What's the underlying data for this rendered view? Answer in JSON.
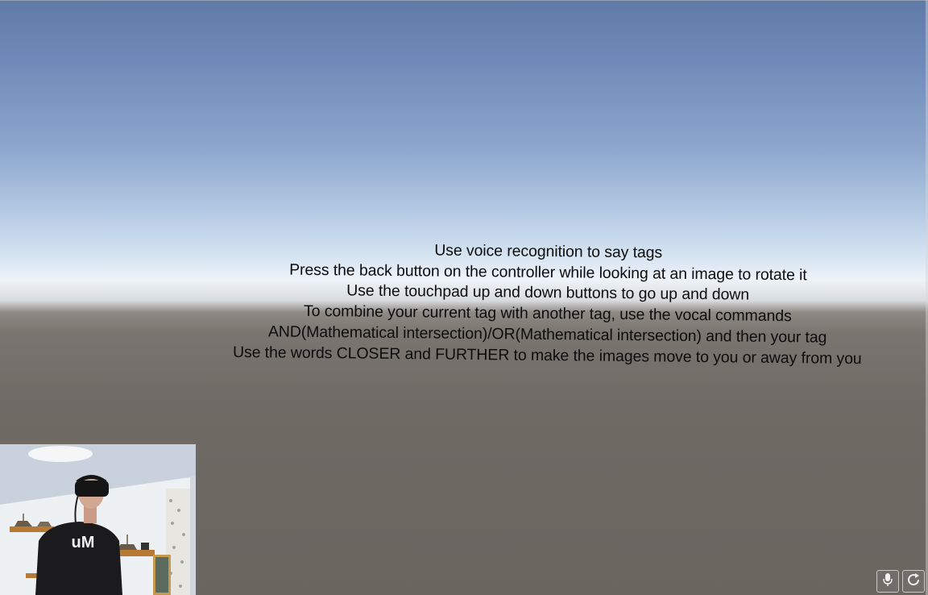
{
  "scene": {
    "instructions": [
      "Use voice recognition to say tags",
      "Press the back button on the controller while looking at an image to rotate it",
      "Use the touchpad up and down buttons to go up and down",
      "To combine your current tag with another tag, use the vocal commands",
      "AND(Mathematical intersection)/OR(Mathematical intersection) and then your tag",
      "Use the words CLOSER and FURTHER to make the images move to you or away from you"
    ]
  },
  "webcam": {
    "shirt_logo": "uM"
  },
  "controls": {
    "microphone_icon": "microphone-icon",
    "refresh_icon": "refresh-icon"
  },
  "colors": {
    "sky_top": "#5f7aa6",
    "horizon": "#eef3f8",
    "ground": "#6b6560",
    "text": "#0d0d0d"
  }
}
